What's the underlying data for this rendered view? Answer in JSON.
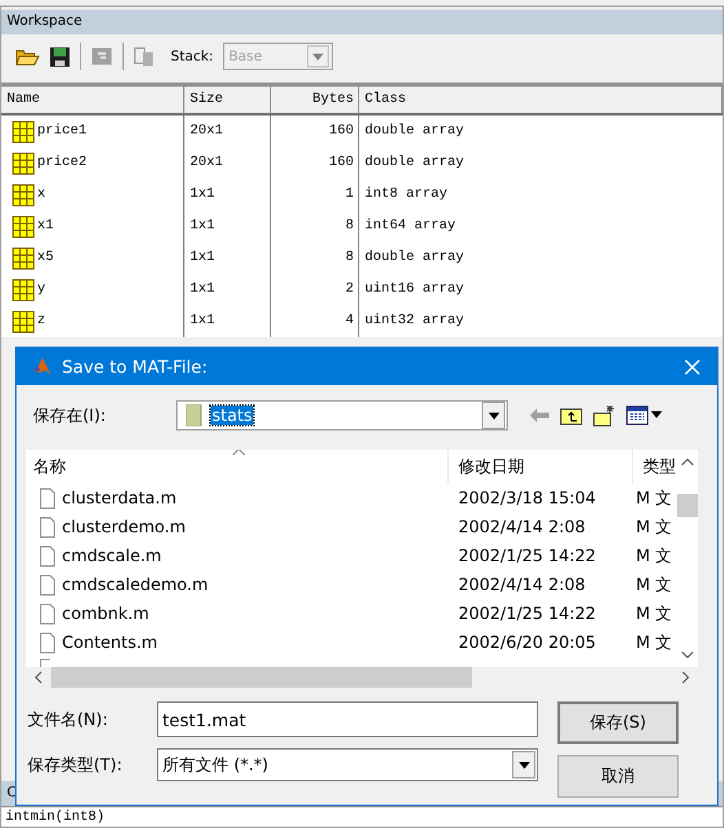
{
  "workspace": {
    "title": "Workspace",
    "stack_label": "Stack:",
    "stack_value": "Base",
    "stack_disabled": true,
    "columns": [
      "Name",
      "Size",
      "Bytes",
      "Class"
    ],
    "rows": [
      {
        "name": "price1",
        "size": "20x1",
        "bytes": "160",
        "class": "double array"
      },
      {
        "name": "price2",
        "size": "20x1",
        "bytes": "160",
        "class": "double array"
      },
      {
        "name": "x",
        "size": "1x1",
        "bytes": "1",
        "class": "int8 array"
      },
      {
        "name": "x1",
        "size": "1x1",
        "bytes": "8",
        "class": "int64 array"
      },
      {
        "name": "x5",
        "size": "1x1",
        "bytes": "8",
        "class": "double array"
      },
      {
        "name": "y",
        "size": "1x1",
        "bytes": "2",
        "class": "uint16 array"
      },
      {
        "name": "z",
        "size": "1x1",
        "bytes": "4",
        "class": "uint32 array"
      }
    ]
  },
  "command_window": {
    "title": "C",
    "line": "intmin(int8)"
  },
  "dialog": {
    "title": "Save to MAT-File:",
    "save_in_label": "保存在(I):",
    "folder": "stats",
    "columns": [
      "名称",
      "修改日期",
      "类型"
    ],
    "files": [
      {
        "name": "clusterdata.m",
        "date": "2002/3/18 15:04",
        "type": "M 文"
      },
      {
        "name": "clusterdemo.m",
        "date": "2002/4/14 2:08",
        "type": "M 文"
      },
      {
        "name": "cmdscale.m",
        "date": "2002/1/25 14:22",
        "type": "M 文"
      },
      {
        "name": "cmdscaledemo.m",
        "date": "2002/4/14 2:08",
        "type": "M 文"
      },
      {
        "name": "combnk.m",
        "date": "2002/1/25 14:22",
        "type": "M 文"
      },
      {
        "name": "Contents.m",
        "date": "2002/6/20 20:05",
        "type": "M 文"
      }
    ],
    "filename_label": "文件名(N):",
    "filename": "test1.mat",
    "filetype_label": "保存类型(T):",
    "filetype": "所有文件 (*.*)",
    "save_button": "保存(S)",
    "cancel_button": "取消"
  }
}
